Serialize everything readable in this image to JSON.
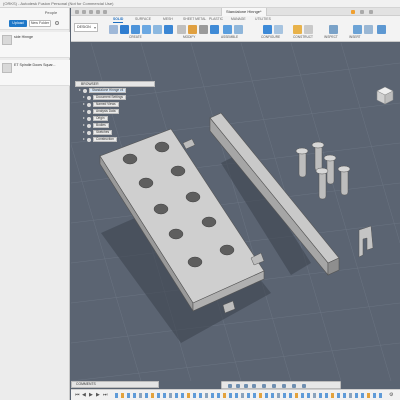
{
  "title_bar": {
    "text": "(ORKS) - Autodesk Fusion Personal (Not for Commercial Use)"
  },
  "data_panel": {
    "tabs": [
      "",
      "People"
    ],
    "upload_label": "Upload",
    "new_folder_label": "New Folder",
    "items": [
      {
        "name": "side Hinnge",
        "meta": ""
      },
      {
        "name": "ET Spindle Doors Squar...",
        "meta": ""
      }
    ]
  },
  "document": {
    "tab_label": "Standalone Hinnge*"
  },
  "toolbar": {
    "workspace_label": "DESIGN",
    "tabs": [
      "SOLID",
      "SURFACE",
      "MESH",
      "SHEET METAL",
      "PLASTIC",
      "MANAGE",
      "UTILITIES"
    ],
    "active_tab": "SOLID",
    "groups": [
      "CREATE",
      "MODIFY",
      "ASSEMBLE",
      "CONFIGURE",
      "CONSTRUCT",
      "INSPECT",
      "INSERT"
    ]
  },
  "browser": {
    "title": "BROWSER",
    "root": "Standalone Hinnge v4",
    "items": [
      "Document Settings",
      "Named Views",
      "Analysis Data",
      "Origin",
      "Bodies",
      "Sketches",
      "Construction"
    ]
  },
  "comments": {
    "label": "COMMENTS"
  },
  "colors": {
    "accent": "#1f6fc0",
    "viewport": "#5b6472",
    "part_gray": "#b9b9b9"
  }
}
